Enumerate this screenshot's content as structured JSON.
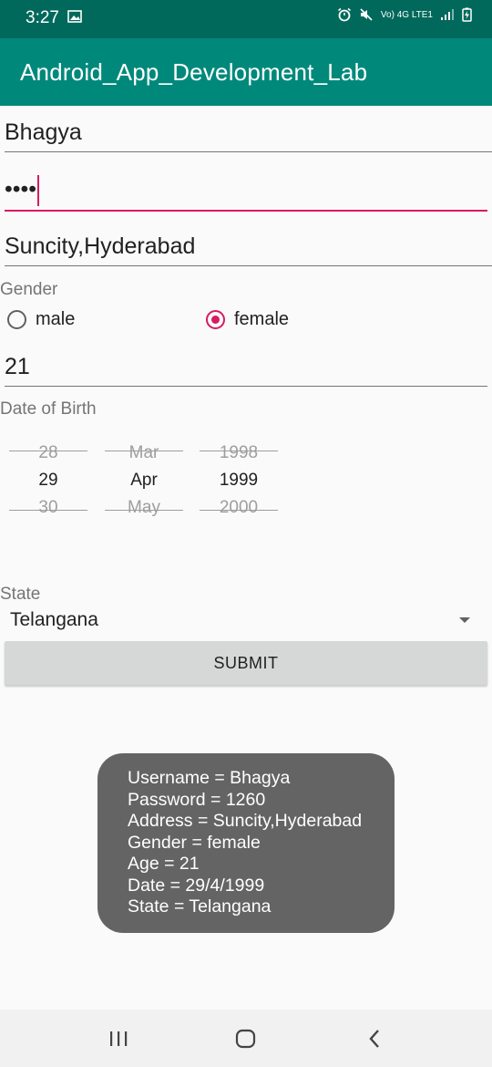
{
  "status_bar": {
    "time": "3:27",
    "indicators": "Vo) 4G LTE1"
  },
  "app_bar": {
    "title": "Android_App_Development_Lab"
  },
  "form": {
    "username": "Bhagya",
    "password_masked": "••••",
    "address": "Suncity,Hyderabad",
    "gender_label": "Gender",
    "gender_options": [
      {
        "label": "male",
        "checked": false
      },
      {
        "label": "female",
        "checked": true
      }
    ],
    "age": "21",
    "dob_label": "Date of Birth",
    "date_picker": {
      "day": {
        "prev": "28",
        "current": "29",
        "next": "30"
      },
      "month": {
        "prev": "Mar",
        "current": "Apr",
        "next": "May"
      },
      "year": {
        "prev": "1998",
        "current": "1999",
        "next": "2000"
      }
    },
    "state_label": "State",
    "state_value": "Telangana",
    "submit_label": "SUBMIT"
  },
  "toast": {
    "lines": [
      "Username = Bhagya",
      "Password = 1260",
      "Address = Suncity,Hyderabad",
      "Gender = female",
      "Age = 21",
      "Date = 29/4/1999",
      "State = Telangana"
    ]
  },
  "colors": {
    "status_bar": "#00695c",
    "app_bar": "#00897b",
    "accent": "#d81b60",
    "toast_bg": "#646464"
  }
}
